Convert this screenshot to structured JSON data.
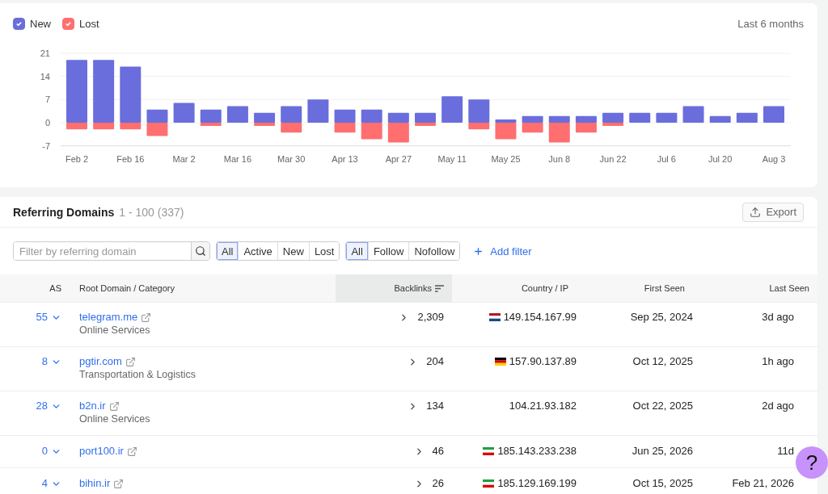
{
  "legend": [
    {
      "checked": true
    },
    {
      "checked": true
    }
  ],
  "period": "Last 6 months",
  "chart_data": {
    "type": "bar",
    "stacked": true,
    "categories": [
      "Feb 2",
      null,
      "Feb 16",
      null,
      "Mar 2",
      null,
      "Mar 16",
      null,
      "Mar 30",
      null,
      "Apr 13",
      null,
      "Apr 27",
      null,
      "May 11",
      null,
      "May 25",
      null,
      "Jun 8",
      null,
      "Jun 22",
      null,
      "Jul 6",
      null,
      "Jul 20",
      null,
      "Aug 3"
    ],
    "series": [
      {
        "name": "New",
        "color": "#6a6ddc",
        "values": [
          19,
          19,
          17,
          4,
          6,
          4,
          5,
          3,
          5,
          7,
          4,
          4,
          3,
          3,
          8,
          7,
          1,
          2,
          2,
          2,
          3,
          3,
          3,
          5,
          2,
          3,
          5
        ]
      },
      {
        "name": "Lost",
        "color": "#ff6f70",
        "values": [
          -2,
          -2,
          -2,
          -4,
          0,
          -1,
          0,
          -1,
          -3,
          0,
          -3,
          -5,
          -6,
          -1,
          0,
          -2,
          -5,
          -3,
          -6,
          -3,
          -1,
          0,
          0,
          0,
          0,
          0,
          0
        ]
      }
    ],
    "ylim": [
      -7,
      21
    ],
    "yticks": [
      -7,
      0,
      7,
      14,
      21
    ],
    "grid": true
  },
  "referring_domains": {
    "title": "Referring Domains",
    "range": "1 - 100 (337)",
    "export": "Export",
    "filter": {
      "placeholder": "Filter by referring domain"
    },
    "status_filters": [
      {
        "label": "All",
        "selected": true
      },
      {
        "label": "Active",
        "selected": false
      },
      {
        "label": "New",
        "selected": false
      },
      {
        "label": "Lost",
        "selected": false
      }
    ],
    "link_filters": [
      {
        "label": "All",
        "selected": true
      },
      {
        "label": "Follow",
        "selected": false
      },
      {
        "label": "Nofollow",
        "selected": false
      }
    ],
    "add_filter": "Add filter",
    "columns": [
      {
        "label": "AS",
        "sorted": false
      },
      {
        "label": "Root Domain / Category",
        "sorted": false
      },
      {
        "label": "Backlinks",
        "sorted": true
      },
      {
        "label": "Country / IP",
        "sorted": false
      },
      {
        "label": "First Seen",
        "sorted": false
      },
      {
        "label": "Last Seen",
        "sorted": false
      }
    ],
    "rows": [
      {
        "as": "55",
        "domain": "telegram.me",
        "category": "Online Services",
        "backlinks": "2,309",
        "kind": "nl",
        "ip": "149.154.167.99",
        "first_seen": "Sep 25, 2024",
        "last_seen": "3d ago"
      },
      {
        "as": "8",
        "domain": "pgtir.com",
        "category": "Transportation & Logistics",
        "backlinks": "204",
        "kind": "de",
        "ip": "157.90.137.89",
        "first_seen": "Oct 12, 2025",
        "last_seen": "1h ago"
      },
      {
        "as": "28",
        "domain": "b2n.ir",
        "category": "Online Services",
        "backlinks": "134",
        "ip": "104.21.93.182",
        "first_seen": "Oct 22, 2025",
        "last_seen": "2d ago"
      },
      {
        "as": "0",
        "domain": "port100.ir",
        "backlinks": "46",
        "kind": "ir",
        "ip": "185.143.233.238",
        "first_seen": "Jun 25, 2026",
        "last_seen": "11d"
      },
      {
        "as": "4",
        "domain": "bihin.ir",
        "backlinks": "26",
        "kind": "ir",
        "ip": "185.129.169.199",
        "first_seen": "Oct 15, 2025",
        "last_seen": "Feb 21, 2026"
      }
    ]
  },
  "help": "?"
}
